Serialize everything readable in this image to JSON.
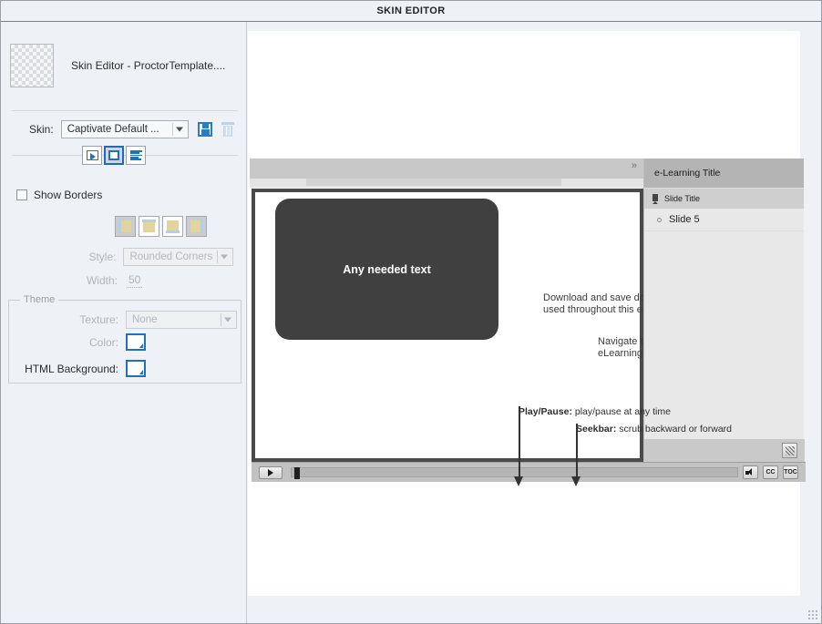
{
  "window": {
    "title": "SKIN EDITOR"
  },
  "left_panel": {
    "header_title": "Skin Editor - ProctorTemplate....",
    "thumbnail_icon": "transparent-checker-thumbnail",
    "skin": {
      "label": "Skin:",
      "selected": "Captivate Default ...",
      "save_icon": "save-icon",
      "delete_icon": "trash-icon"
    },
    "tabs": [
      {
        "name": "playback-control",
        "icon": "play-button-icon",
        "active": false
      },
      {
        "name": "borders",
        "icon": "square-border-icon",
        "active": true
      },
      {
        "name": "table-of-contents",
        "icon": "list-lines-icon",
        "active": false
      }
    ],
    "show_borders": {
      "label": "Show Borders",
      "checked": false
    },
    "border_sides": [
      {
        "name": "border-left",
        "active": true
      },
      {
        "name": "border-top",
        "active": false
      },
      {
        "name": "border-bottom",
        "active": false
      },
      {
        "name": "border-right",
        "active": true
      }
    ],
    "style": {
      "label": "Style:",
      "value": "Rounded Corners",
      "disabled": true
    },
    "width": {
      "label": "Width:",
      "value": "50",
      "disabled": true
    },
    "theme": {
      "group_label": "Theme",
      "texture": {
        "label": "Texture:",
        "value": "None",
        "disabled": true
      },
      "color": {
        "label": "Color:",
        "swatch": "#ffffff",
        "disabled": true
      },
      "html_background": {
        "label": "HTML Background:",
        "swatch": "#ffffff",
        "disabled": false
      }
    }
  },
  "preview": {
    "collapse_icon": "chevron-double-right-icon",
    "stage": {
      "dark_box_text": "Any needed text",
      "body_text_1": "Download and save documents used throughout this eLearning",
      "body_text_2": "Navigate through the eLearning"
    },
    "annotations": [
      {
        "title": "Play/Pause:",
        "text": " play/pause at any time"
      },
      {
        "title": "Seekbar:",
        "text": " scrub backward or forward"
      }
    ],
    "playbar": {
      "play_icon": "play-icon",
      "seek_label": "seekbar",
      "audio_icon": "speaker-icon",
      "cc_label": "CC",
      "toc_label": "TOC"
    },
    "toc": {
      "title": "e-Learning Title",
      "subtitle": "Slide Title",
      "bookmark_icon": "bookmark-icon",
      "items": [
        {
          "label": "Slide 5",
          "icon": "circle-dot-icon"
        }
      ],
      "footer_icon": "resize-grip-icon"
    }
  }
}
